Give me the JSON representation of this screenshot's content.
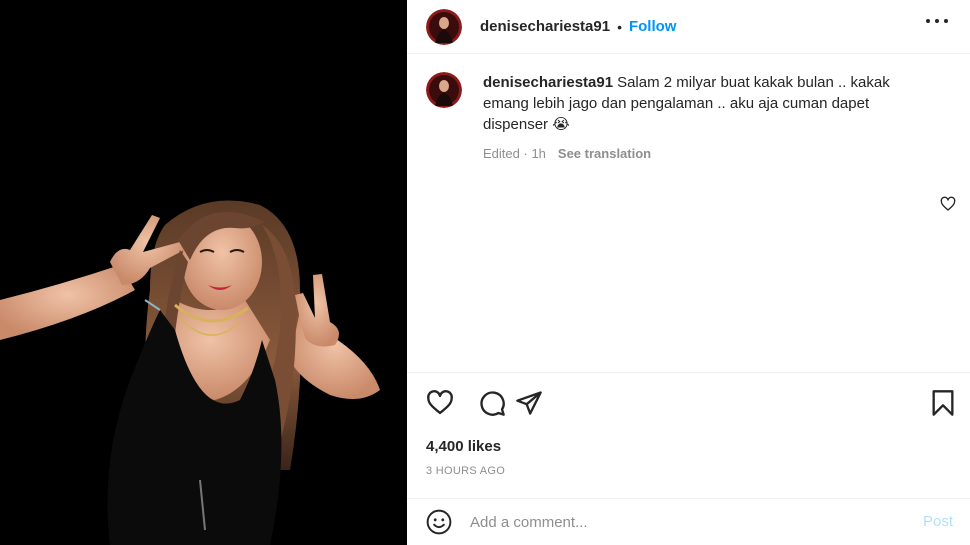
{
  "post": {
    "author": {
      "username": "denisechariesta91",
      "follow_label": "Follow",
      "separator": "•"
    },
    "caption": {
      "username": "denisechariesta91",
      "text": "Salam 2 milyar buat kakak bulan .. kakak emang lebih jago dan pengalaman .. aku aja cuman dapet dispenser 😭",
      "edited_label": "Edited",
      "age": "1h",
      "meta_separator": " · ",
      "see_translation_label": "See translation"
    },
    "actions": {
      "icons": [
        "heart-icon",
        "comment-icon",
        "share-icon",
        "bookmark-icon"
      ]
    },
    "likes_label": "4,400 likes",
    "timestamp": "3 HOURS AGO",
    "comment": {
      "placeholder": "Add a comment...",
      "post_label": "Post"
    },
    "colors": {
      "link": "#0095f6",
      "post_disabled": "#b2dffc",
      "muted": "#8e8e8e",
      "text": "#262626"
    }
  }
}
